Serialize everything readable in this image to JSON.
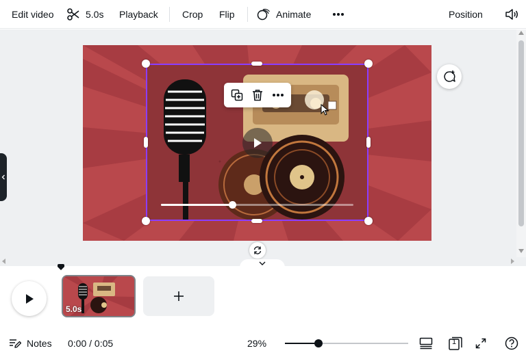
{
  "toolbar": {
    "edit_video": "Edit video",
    "duration": "5.0s",
    "playback": "Playback",
    "crop": "Crop",
    "flip": "Flip",
    "animate": "Animate",
    "position": "Position"
  },
  "timeline": {
    "clip_duration": "5.0s",
    "add_clip_symbol": "+"
  },
  "bottombar": {
    "notes": "Notes",
    "time": "0:00 / 0:05",
    "zoom": "29%",
    "page_number": "1"
  },
  "video_progress": 0.37,
  "zoom_slider_value": 0.27,
  "colors": {
    "accent": "#8b3dff",
    "design_background": "#b9484c",
    "workspace": "#eef0f2"
  },
  "icons": [
    "scissors-icon",
    "animate-icon",
    "more-icon",
    "speaker-icon",
    "duplicate-icon",
    "trash-icon",
    "play-icon",
    "comment-add-icon",
    "rotate-icon",
    "chevron-left-icon",
    "chevron-down-icon",
    "notes-icon",
    "grid-view-icon",
    "page-count-icon",
    "fullscreen-icon",
    "help-icon"
  ]
}
